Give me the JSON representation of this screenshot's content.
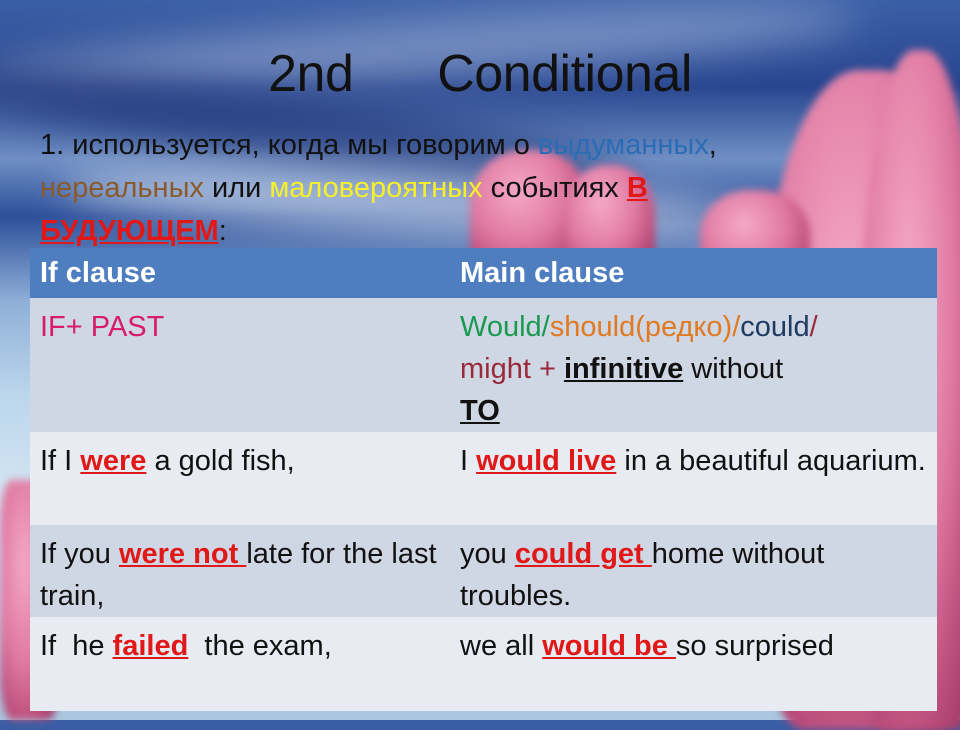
{
  "title": "2nd   Conditional",
  "intro": {
    "number": "1.",
    "part1": " используется, когда мы  говорим о ",
    "word_fictional": "выдуманных",
    "comma": ",",
    "word_unreal": "нереальных",
    "or": " или ",
    "word_unlikely": "маловероятных",
    "events": " событиях ",
    "in": "В",
    "future": "БУДУЮЩЕМ",
    "colon": ":"
  },
  "table": {
    "headers": [
      "If clause",
      "Main clause"
    ],
    "formula": {
      "if_part": "IF+ PAST",
      "would": "Would/",
      "should": "should(редко)/",
      "could": "could",
      "slash": "/",
      "might": "might + ",
      "infinitive": "infinitive",
      "without": " without",
      "to": "TO"
    },
    "rows": [
      {
        "if_pre": "If I ",
        "if_hl": "were",
        "if_post": " a gold fish,",
        "main_pre": "I ",
        "main_hl": "would live",
        "main_post": " in a beautiful aquarium."
      },
      {
        "if_pre": "If you ",
        "if_hl": "were not ",
        "if_post": "late for the last train,",
        "main_pre": "you ",
        "main_hl": "could  get ",
        "main_post": "home without troubles."
      },
      {
        "if_pre": "If  he ",
        "if_hl": "failed",
        "if_post": "  the exam,",
        "main_pre": "we all ",
        "main_hl": "would be ",
        "main_post": "so surprised"
      }
    ]
  },
  "colors": {
    "header_bg": "#4e7dc0",
    "highlight_red": "#e01818",
    "if_past_pink": "#d81c6a",
    "would_green": "#1a9a50",
    "should_orange": "#e07a20",
    "fictional_blue": "#2a6db5",
    "unreal_brown": "#8a5a2a",
    "unlikely_yellow": "#f6f02a"
  }
}
